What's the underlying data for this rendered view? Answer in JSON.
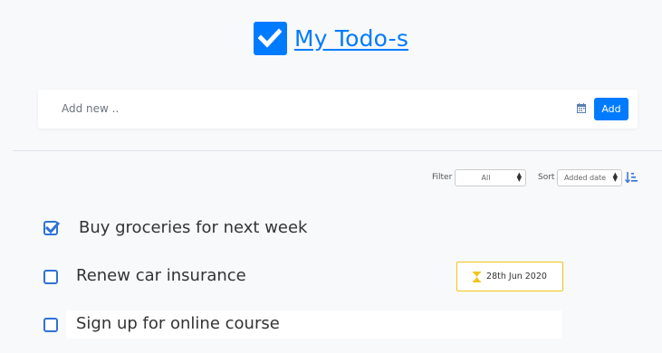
{
  "header": {
    "title": "My Todo-s"
  },
  "add": {
    "placeholder": "Add new ..",
    "button_label": "Add"
  },
  "controls": {
    "filter_label": "Filter",
    "filter_value": "All",
    "sort_label": "Sort",
    "sort_value": "Added date"
  },
  "todos": [
    {
      "text": "Buy groceries for next week",
      "checked": true
    },
    {
      "text": "Renew car insurance",
      "checked": false,
      "due_date": "28th Jun 2020"
    },
    {
      "text": "Sign up for online course",
      "checked": false
    }
  ],
  "colors": {
    "accent": "#007bff",
    "warning": "#f0c419"
  },
  "icons": [
    "check-icon",
    "calendar-icon",
    "sort-icon",
    "hourglass-icon"
  ]
}
